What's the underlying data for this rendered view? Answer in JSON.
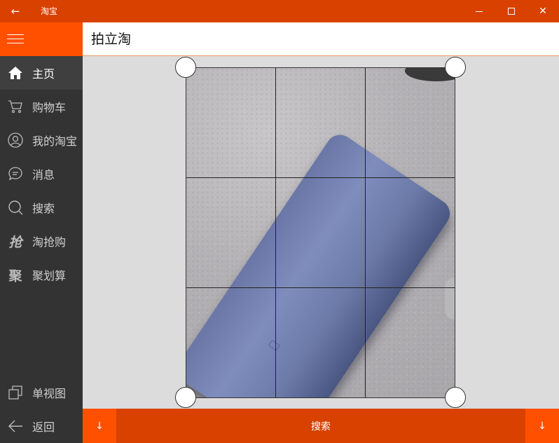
{
  "window": {
    "title": "淘宝",
    "back_icon": "arrow-left-icon"
  },
  "colors": {
    "accent": "#ff5000",
    "titlebar": "#d94100",
    "sidebar_bg": "#333333"
  },
  "sidebar": {
    "menu_icon": "hamburger-menu-icon",
    "items": [
      {
        "label": "主页",
        "icon": "home-icon",
        "active": true
      },
      {
        "label": "购物车",
        "icon": "cart-icon",
        "active": false
      },
      {
        "label": "我的淘宝",
        "icon": "user-circle-icon",
        "active": false
      },
      {
        "label": "消息",
        "icon": "chat-bubble-icon",
        "active": false
      },
      {
        "label": "搜索",
        "icon": "search-icon",
        "active": false
      },
      {
        "label": "淘抢购",
        "icon": "qiang-icon",
        "active": false
      },
      {
        "label": "聚划算",
        "icon": "ju-icon",
        "active": false
      }
    ],
    "bottom_items": [
      {
        "label": "单视图",
        "icon": "single-view-icon"
      },
      {
        "label": "返回",
        "icon": "back-arrow-icon"
      }
    ]
  },
  "header": {
    "title": "拍立淘"
  },
  "crop": {
    "grid": "3x3",
    "image": "power-bank-photo"
  },
  "bottom_bar": {
    "search_label": "搜索",
    "left_icon": "down-arrow-icon",
    "right_icon": "down-arrow-icon",
    "left_glyph": "↓",
    "right_glyph": "↓"
  },
  "glyphs": {
    "qiang": "抢",
    "ju": "聚"
  }
}
